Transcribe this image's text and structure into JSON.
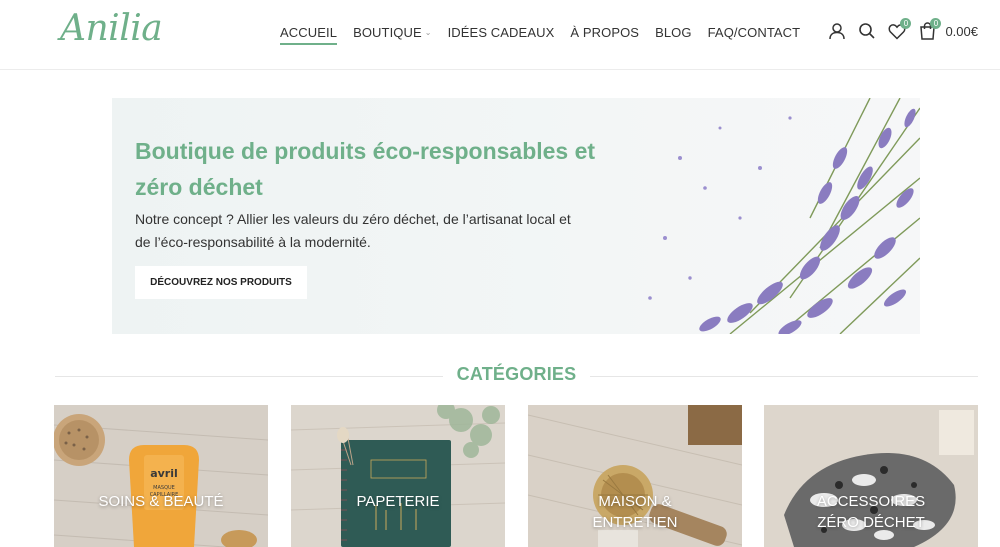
{
  "header": {
    "logo": "Anilia",
    "nav": [
      {
        "label": "ACCUEIL",
        "active": true
      },
      {
        "label": "BOUTIQUE",
        "dropdown": true
      },
      {
        "label": "IDÉES CADEAUX"
      },
      {
        "label": "À PROPOS"
      },
      {
        "label": "BLOG"
      },
      {
        "label": "FAQ/CONTACT"
      }
    ],
    "wishlist_count": "0",
    "cart_count": "0",
    "cart_total": "0.00€"
  },
  "hero": {
    "title": "Boutique de produits éco-responsables et zéro déchet",
    "text": "Notre concept ? Allier les valeurs du zéro déchet, de l’artisanat local et de l’éco-responsabilité à la modernité.",
    "button": "DÉCOUVREZ NOS PRODUITS"
  },
  "categories": {
    "heading": "CATÉGORIES",
    "items": [
      {
        "label": "SOINS & BEAUTÉ",
        "product_text": "avril",
        "product_subtext": "MASQUE CAPILLAIRE"
      },
      {
        "label": "PAPETERIE"
      },
      {
        "label": "MAISON & ENTRETIEN"
      },
      {
        "label": "ACCESSOIRES ZÉRO DÉCHET"
      }
    ]
  },
  "colors": {
    "accent": "#6fb08a",
    "text": "#333333",
    "lavender": "#8a7cc0"
  },
  "icons": [
    "user-icon",
    "search-icon",
    "heart-icon",
    "cart-icon",
    "chevron-down-icon"
  ]
}
